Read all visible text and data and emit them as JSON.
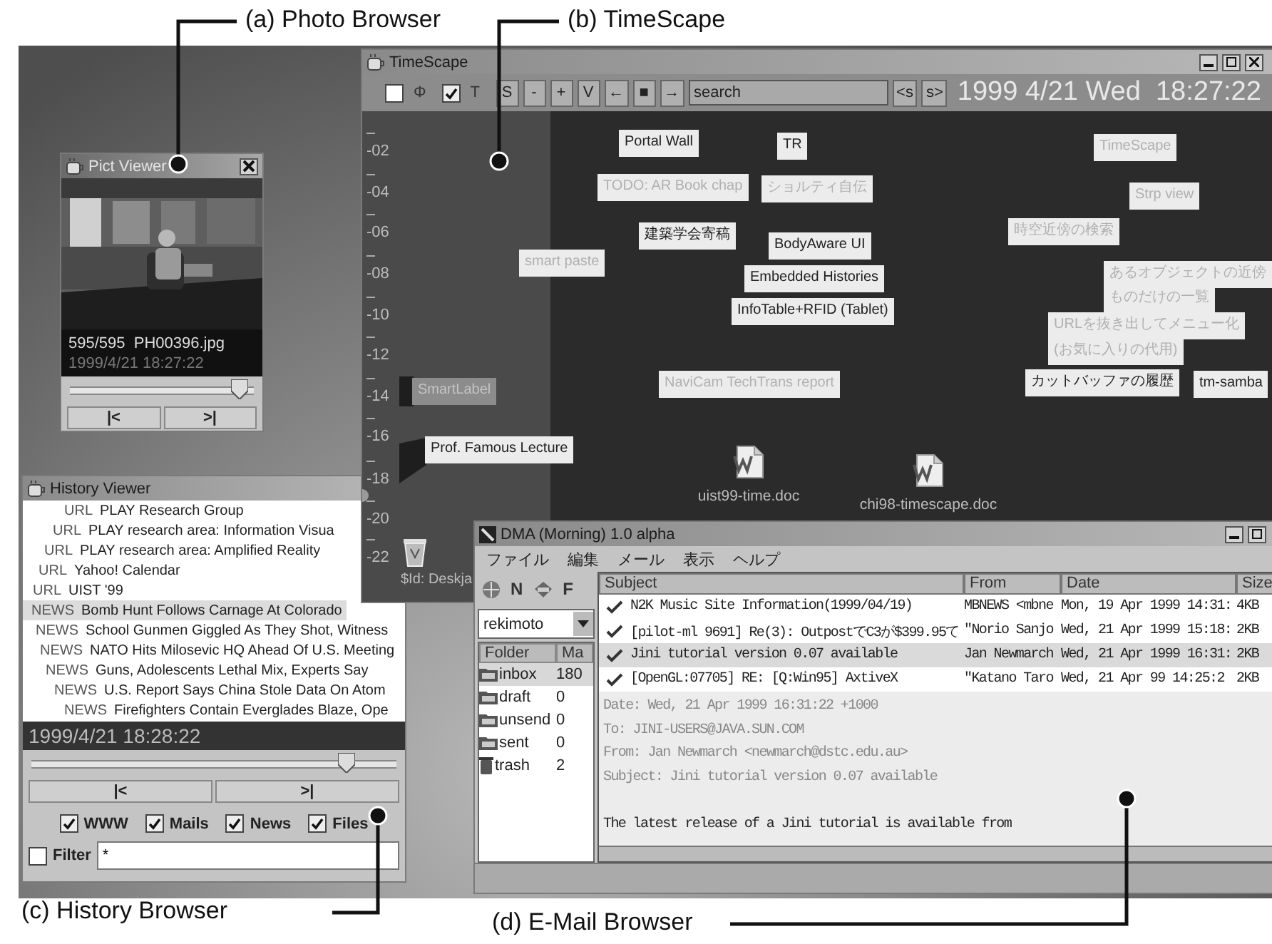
{
  "callouts": [
    {
      "label": "(a) Photo Browser"
    },
    {
      "label": "(b) TimeScape"
    },
    {
      "label": "(c) History Browser"
    },
    {
      "label": "(d) E-Mail Browser"
    }
  ],
  "pict_viewer": {
    "title": "Pict Viewer",
    "caption": "595/595  PH00396.jpg",
    "timestamp": "1999/4/21 18:27:22",
    "slider": {
      "level": 0.97
    },
    "buttons": [
      "|<",
      ">|"
    ]
  },
  "timescape": {
    "title": "TimeScape",
    "toolbar": {
      "checkboxes": [
        {
          "label": "Φ",
          "checked": false
        },
        {
          "label": "T",
          "checked": true
        }
      ],
      "buttons": [
        "S",
        "-",
        "+",
        "V",
        "←",
        "■",
        "→"
      ],
      "search": {
        "value": "search"
      },
      "nav_buttons": [
        "<s",
        "s>"
      ],
      "datetime": "1999 4/21 Wed  18:27:22"
    },
    "ruler": [
      "-02",
      "-04",
      "-06",
      "-08",
      "-10",
      "-12",
      "-14",
      "-16",
      "-18",
      "-20",
      "-22"
    ],
    "items": [
      {
        "text": "Portal Wall",
        "kind": "note"
      },
      {
        "text": "TR",
        "kind": "note"
      },
      {
        "text": "TimeScape",
        "kind": "faded"
      },
      {
        "text": "TODO: AR Book chap",
        "kind": "faded"
      },
      {
        "text": "ショルティ自伝",
        "kind": "faded"
      },
      {
        "text": "Strp view",
        "kind": "faded"
      },
      {
        "text": "建築学会寄稿",
        "kind": "note"
      },
      {
        "text": "BodyAware UI",
        "kind": "note"
      },
      {
        "text": "時空近傍の検索",
        "kind": "faded"
      },
      {
        "text": "smart paste",
        "kind": "faded"
      },
      {
        "text": "Embedded Histories",
        "kind": "note"
      },
      {
        "text": "あるオブジェクトの近傍",
        "kind": "faded"
      },
      {
        "text": "InfoTable+RFID (Tablet)",
        "kind": "note"
      },
      {
        "text": "ものだけの一覧",
        "kind": "faded"
      },
      {
        "text": "URLを抜き出してメニュー化",
        "kind": "faded"
      },
      {
        "text": "(お気に入りの代用)",
        "kind": "faded"
      },
      {
        "text": "SmartLabel",
        "kind": "tag"
      },
      {
        "text": "NaviCam TechTrans report",
        "kind": "faded"
      },
      {
        "text": "カットバッファの履歴",
        "kind": "note"
      },
      {
        "text": "tm-samba",
        "kind": "note"
      },
      {
        "text": "Prof. Famous Lecture",
        "kind": "note"
      }
    ],
    "files": [
      {
        "name": "uist99-time.doc"
      },
      {
        "name": "chi98-timescape.doc"
      }
    ],
    "trash_label": "$Id: Deskja"
  },
  "history_viewer": {
    "title": "History Viewer",
    "entries": [
      {
        "tag": "URL",
        "text": "PLAY Research Group",
        "selected": false
      },
      {
        "tag": "URL",
        "text": "PLAY research area: Information Visua",
        "selected": false
      },
      {
        "tag": "URL",
        "text": "PLAY research area: Amplified Reality",
        "selected": false
      },
      {
        "tag": "URL",
        "text": "Yahoo! Calendar",
        "selected": false
      },
      {
        "tag": "URL",
        "text": "UIST '99",
        "selected": false
      },
      {
        "tag": "NEWS",
        "text": "Bomb Hunt Follows Carnage At Colorado",
        "selected": true
      },
      {
        "tag": "NEWS",
        "text": "School Gunmen Giggled As They Shot, Witness",
        "selected": false
      },
      {
        "tag": "NEWS",
        "text": "NATO Hits Milosevic HQ Ahead Of U.S. Meeting",
        "selected": false
      },
      {
        "tag": "NEWS",
        "text": "Guns, Adolescents Lethal Mix, Experts Say",
        "selected": false
      },
      {
        "tag": "NEWS",
        "text": "U.S. Report Says China Stole Data On Atom",
        "selected": false
      },
      {
        "tag": "NEWS",
        "text": "Firefighters Contain Everglades Blaze, Ope",
        "selected": false
      }
    ],
    "current_time": "1999/4/21 18:28:22",
    "slider": {
      "level": 0.88
    },
    "buttons": [
      "|<",
      ">|"
    ],
    "sources": [
      {
        "label": "WWW",
        "checked": true
      },
      {
        "label": "Mails",
        "checked": true
      },
      {
        "label": "News",
        "checked": true
      },
      {
        "label": "Files",
        "checked": true
      }
    ],
    "filter": {
      "label": "Filter",
      "checked": false,
      "value": "*"
    }
  },
  "mail": {
    "title": "DMA (Morning) 1.0 alpha",
    "menu": [
      "ファイル",
      "編集",
      "メール",
      "表示",
      "ヘルプ"
    ],
    "toolbar": [
      "N",
      "F"
    ],
    "account": "rekimoto",
    "folder_columns": [
      "Folder",
      "Ma"
    ],
    "folders": [
      {
        "name": "inbox",
        "count": "180",
        "selected": true
      },
      {
        "name": "draft",
        "count": "0",
        "selected": false
      },
      {
        "name": "unsend",
        "count": "0",
        "selected": false
      },
      {
        "name": "sent",
        "count": "0",
        "selected": false
      },
      {
        "name": "trash",
        "count": "2",
        "selected": false
      }
    ],
    "columns": [
      "Subject",
      "From",
      "Date",
      "Size"
    ],
    "messages": [
      {
        "subject": "N2K Music Site Information(1999/04/19)",
        "from": "MBNEWS <mbne",
        "date": "Mon, 19 Apr 1999 14:31:",
        "size": "4KB",
        "selected": false
      },
      {
        "subject": "[pilot-ml 9691] Re(3): OutpostでC3が$399.95て",
        "from": "\"Norio Sanjo",
        "date": "Wed, 21 Apr 1999 15:18:",
        "size": "2KB",
        "selected": false
      },
      {
        "subject": "Jini tutorial version 0.07 available",
        "from": "Jan Newmarch",
        "date": "Wed, 21 Apr 1999 16:31:",
        "size": "2KB",
        "selected": true
      },
      {
        "subject": "[OpenGL:07705] RE: [Q:Win95] AxtiveX",
        "from": "\"Katano Taro",
        "date": "Wed, 21 Apr 99 14:25:2",
        "size": "2KB",
        "selected": false
      }
    ],
    "preview": {
      "headers": [
        "Date: Wed, 21 Apr 1999 16:31:22 +1000",
        "To: JINI-USERS@JAVA.SUN.COM",
        "From: Jan Newmarch <newmarch@dstc.edu.au>",
        "Subject: Jini tutorial version 0.07 available"
      ],
      "body": [
        "The latest release of a Jini tutorial is available from"
      ]
    }
  }
}
